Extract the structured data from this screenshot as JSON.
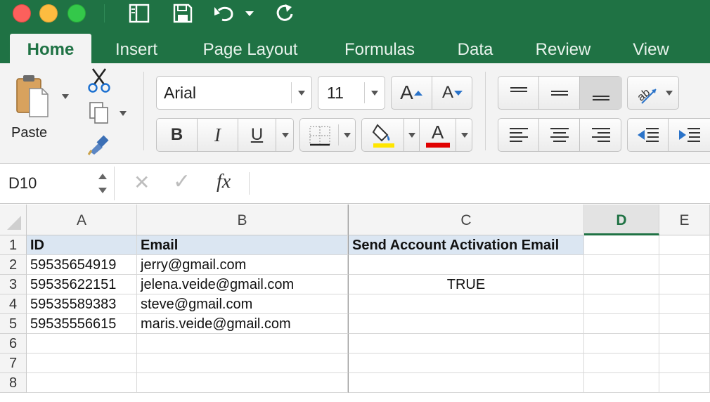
{
  "title_bar": {
    "quick_access": [
      {
        "name": "sidebar-toggle-icon"
      },
      {
        "name": "save-icon"
      },
      {
        "name": "undo-icon"
      },
      {
        "name": "undo-dropdown-icon"
      },
      {
        "name": "redo-icon"
      }
    ]
  },
  "tabs": [
    {
      "label": "Home",
      "active": true
    },
    {
      "label": "Insert"
    },
    {
      "label": "Page Layout"
    },
    {
      "label": "Formulas"
    },
    {
      "label": "Data"
    },
    {
      "label": "Review"
    },
    {
      "label": "View"
    }
  ],
  "ribbon": {
    "paste_label": "Paste",
    "font_name": "Arial",
    "font_size": "11",
    "bold": "B",
    "italic": "I",
    "underline": "U",
    "font_color_letter": "A",
    "increase_font_letter": "A",
    "decrease_font_letter": "A",
    "fill_color": "#ffe600",
    "font_color": "#e00000"
  },
  "formula_bar": {
    "name_box": "D10",
    "cancel_glyph": "✕",
    "enter_glyph": "✓",
    "fx_label": "fx",
    "formula": ""
  },
  "sheet": {
    "columns": [
      "A",
      "B",
      "C",
      "D",
      "E"
    ],
    "selected_column": "D",
    "rows": [
      "1",
      "2",
      "3",
      "4",
      "5",
      "6",
      "7",
      "8"
    ],
    "cells": [
      [
        "ID",
        "Email",
        "Send Account Activation Email",
        "",
        ""
      ],
      [
        "59535654919",
        "jerry@gmail.com",
        "",
        "",
        ""
      ],
      [
        "59535622151",
        "jelena.veide@gmail.com",
        "TRUE",
        "",
        ""
      ],
      [
        "59535589383",
        "steve@gmail.com",
        "",
        "",
        ""
      ],
      [
        "59535556615",
        "maris.veide@gmail.com",
        "",
        "",
        ""
      ],
      [
        "",
        "",
        "",
        "",
        ""
      ],
      [
        "",
        "",
        "",
        "",
        ""
      ],
      [
        "",
        "",
        "",
        "",
        ""
      ]
    ]
  },
  "colors": {
    "excel_green": "#1f7244",
    "header_fill": "#dbe6f2",
    "selected_column_accent": "#1f7244"
  }
}
